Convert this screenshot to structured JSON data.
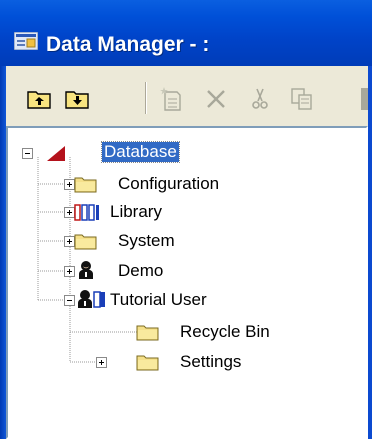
{
  "window": {
    "title": "Data Manager - :",
    "app_icon": "data-manager-icon"
  },
  "toolbar": {
    "buttons": [
      {
        "name": "folder-up-icon",
        "enabled": true
      },
      {
        "name": "folder-down-icon",
        "enabled": true
      },
      {
        "name": "new-item-icon",
        "enabled": false
      },
      {
        "name": "delete-icon",
        "enabled": false
      },
      {
        "name": "cut-icon",
        "enabled": false
      },
      {
        "name": "copy-icon",
        "enabled": false
      }
    ]
  },
  "tree": {
    "root": {
      "label": "Database",
      "icon": "database-icon",
      "expanded": true,
      "selected": true
    },
    "children": [
      {
        "label": "Configuration",
        "icon": "folder-icon",
        "expandable": true,
        "expanded": false
      },
      {
        "label": "Library",
        "icon": "library-icon",
        "expandable": true,
        "expanded": false
      },
      {
        "label": "System",
        "icon": "folder-icon",
        "expandable": true,
        "expanded": false
      },
      {
        "label": "Demo",
        "icon": "user-icon",
        "expandable": true,
        "expanded": false
      },
      {
        "label": "Tutorial User",
        "icon": "user-book-icon",
        "expandable": true,
        "expanded": true,
        "children": [
          {
            "label": "Recycle Bin",
            "icon": "folder-icon",
            "expandable": false
          },
          {
            "label": "Settings",
            "icon": "folder-icon",
            "expandable": true,
            "expanded": false
          }
        ]
      }
    ]
  },
  "colors": {
    "titlebar": "#0050d8",
    "selection": "#316ac5",
    "folder": "#f5e08a",
    "toolbar": "#ece9d8"
  }
}
